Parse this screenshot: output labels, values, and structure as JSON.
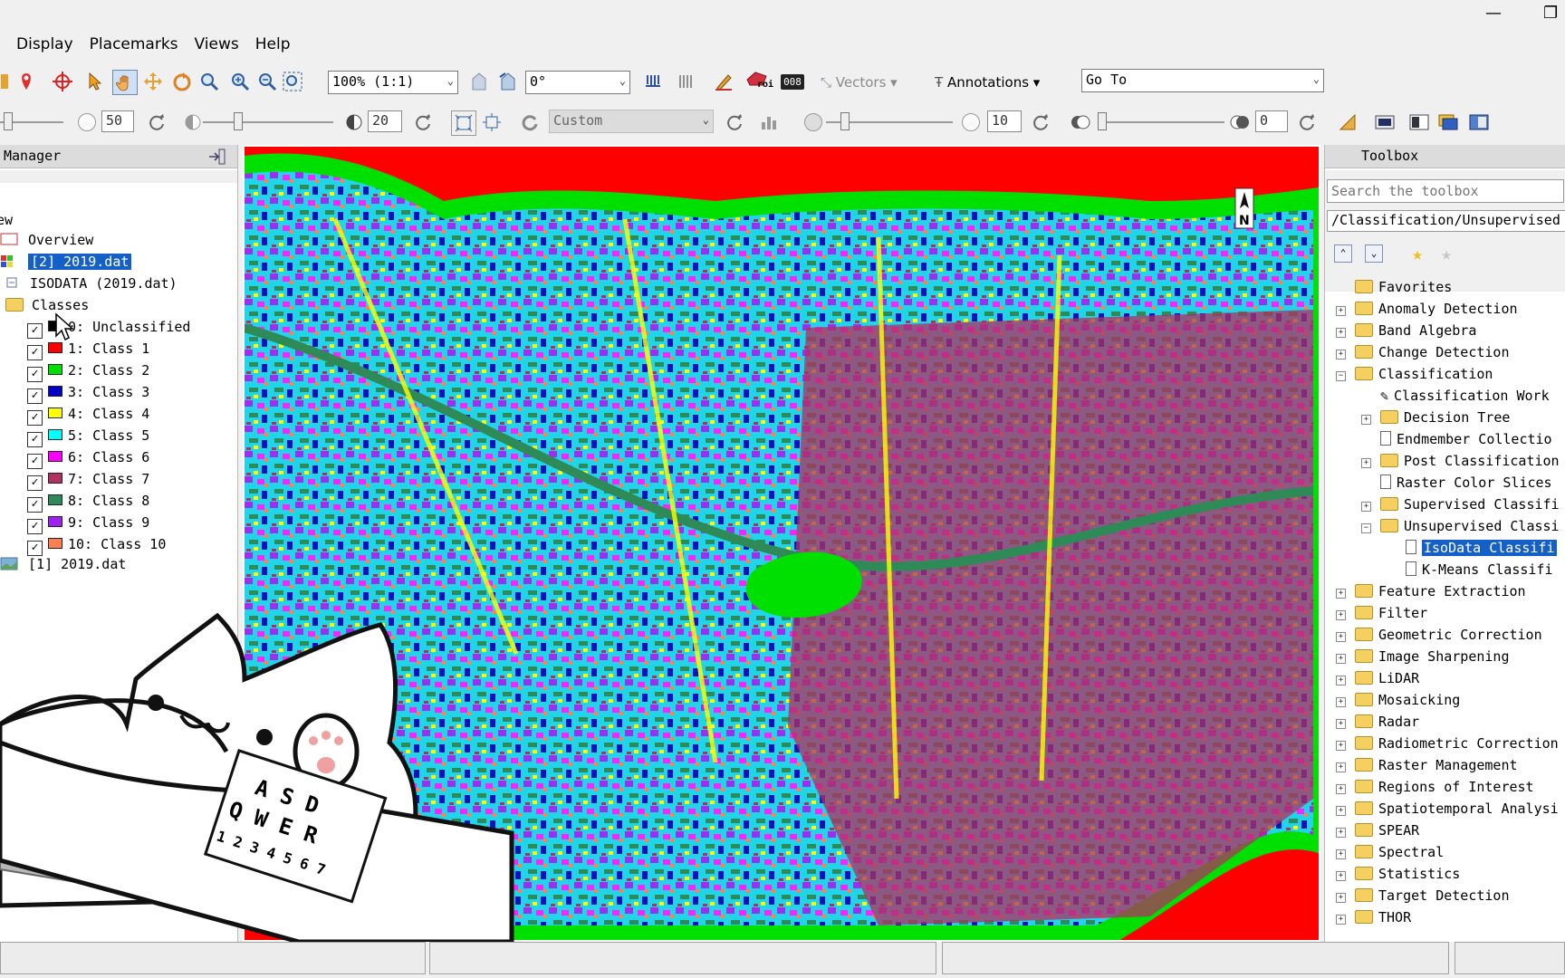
{
  "window": {
    "restore_glyph": "❐",
    "minimize_glyph": "—"
  },
  "menu": [
    "Display",
    "Placemarks",
    "Views",
    "Help"
  ],
  "toolbar1": {
    "zoom_value": "100% (1:1)",
    "rotation_value": "0°",
    "vectors_label": "Vectors",
    "annotations_label": "Annotations",
    "goto_value": "Go To",
    "roi_label": "roi",
    "counter_label": "008"
  },
  "toolbar2": {
    "brightness_value": "50",
    "contrast_value": "20",
    "stretch_value": "Custom",
    "sharpen_value": "10",
    "transparency_value": "0"
  },
  "layer_manager": {
    "title": "Manager",
    "view_label": "ew",
    "overview_label": "Overview",
    "selected_layer": "[2] 2019.dat",
    "isodata_label": "ISODATA (2019.dat)",
    "classes_label": "Classes",
    "classes": [
      {
        "label": "0: Unclassified",
        "color": "#000000"
      },
      {
        "label": "1: Class 1",
        "color": "#ff0000"
      },
      {
        "label": "2: Class 2",
        "color": "#00e000"
      },
      {
        "label": "3: Class 3",
        "color": "#0000c8"
      },
      {
        "label": "4: Class 4",
        "color": "#ffff00"
      },
      {
        "label": "5: Class 5",
        "color": "#00ffff"
      },
      {
        "label": "6: Class 6",
        "color": "#ff00ff"
      },
      {
        "label": "7: Class 7",
        "color": "#b03060"
      },
      {
        "label": "8: Class 8",
        "color": "#2e8b57"
      },
      {
        "label": "9: Class 9",
        "color": "#a020f0"
      },
      {
        "label": "10: Class 10",
        "color": "#ff7f50"
      }
    ],
    "base_layer": "[1] 2019.dat"
  },
  "view": {
    "north_label": "N"
  },
  "toolbox": {
    "title": "Toolbox",
    "search_placeholder": "Search the toolbox",
    "path": "/Classification/Unsupervised C",
    "items": [
      {
        "label": "Favorites",
        "kind": "folder",
        "depth": 0,
        "expander": "",
        "selected": false
      },
      {
        "label": "Anomaly Detection",
        "kind": "folder",
        "depth": 0,
        "expander": "+",
        "selected": false
      },
      {
        "label": "Band Algebra",
        "kind": "folder",
        "depth": 0,
        "expander": "+",
        "selected": false
      },
      {
        "label": "Change Detection",
        "kind": "folder",
        "depth": 0,
        "expander": "+",
        "selected": false
      },
      {
        "label": "Classification",
        "kind": "folder",
        "depth": 0,
        "expander": "−",
        "selected": false
      },
      {
        "label": "Classification Work",
        "kind": "wand",
        "depth": 1,
        "expander": "",
        "selected": false
      },
      {
        "label": "Decision Tree",
        "kind": "folder",
        "depth": 1,
        "expander": "+",
        "selected": false
      },
      {
        "label": "Endmember Collectio",
        "kind": "tool",
        "depth": 1,
        "expander": "",
        "selected": false
      },
      {
        "label": "Post Classification",
        "kind": "folder",
        "depth": 1,
        "expander": "+",
        "selected": false
      },
      {
        "label": "Raster Color Slices",
        "kind": "tool",
        "depth": 1,
        "expander": "",
        "selected": false
      },
      {
        "label": "Supervised Classifi",
        "kind": "folder",
        "depth": 1,
        "expander": "+",
        "selected": false
      },
      {
        "label": "Unsupervised Classi",
        "kind": "folder",
        "depth": 1,
        "expander": "−",
        "selected": false
      },
      {
        "label": "IsoData Classifi",
        "kind": "tool",
        "depth": 2,
        "expander": "",
        "selected": true
      },
      {
        "label": "K-Means Classifi",
        "kind": "tool",
        "depth": 2,
        "expander": "",
        "selected": false
      },
      {
        "label": "Feature Extraction",
        "kind": "folder",
        "depth": 0,
        "expander": "+",
        "selected": false
      },
      {
        "label": "Filter",
        "kind": "folder",
        "depth": 0,
        "expander": "+",
        "selected": false
      },
      {
        "label": "Geometric Correction",
        "kind": "folder",
        "depth": 0,
        "expander": "+",
        "selected": false
      },
      {
        "label": "Image Sharpening",
        "kind": "folder",
        "depth": 0,
        "expander": "+",
        "selected": false
      },
      {
        "label": "LiDAR",
        "kind": "folder",
        "depth": 0,
        "expander": "+",
        "selected": false
      },
      {
        "label": "Mosaicking",
        "kind": "folder",
        "depth": 0,
        "expander": "+",
        "selected": false
      },
      {
        "label": "Radar",
        "kind": "folder",
        "depth": 0,
        "expander": "+",
        "selected": false
      },
      {
        "label": "Radiometric Correction",
        "kind": "folder",
        "depth": 0,
        "expander": "+",
        "selected": false
      },
      {
        "label": "Raster Management",
        "kind": "folder",
        "depth": 0,
        "expander": "+",
        "selected": false
      },
      {
        "label": "Regions of Interest",
        "kind": "folder",
        "depth": 0,
        "expander": "+",
        "selected": false
      },
      {
        "label": "Spatiotemporal Analysi",
        "kind": "folder",
        "depth": 0,
        "expander": "+",
        "selected": false
      },
      {
        "label": "SPEAR",
        "kind": "folder",
        "depth": 0,
        "expander": "+",
        "selected": false
      },
      {
        "label": "Spectral",
        "kind": "folder",
        "depth": 0,
        "expander": "+",
        "selected": false
      },
      {
        "label": "Statistics",
        "kind": "folder",
        "depth": 0,
        "expander": "+",
        "selected": false
      },
      {
        "label": "Target Detection",
        "kind": "folder",
        "depth": 0,
        "expander": "+",
        "selected": false
      },
      {
        "label": "THOR",
        "kind": "folder",
        "depth": 0,
        "expander": "+",
        "selected": false
      }
    ]
  },
  "overlay": {
    "keyboard_row1": "A S D",
    "keyboard_row2": "Q W E R",
    "keyboard_row3": "1 2 3 4 5 6 7"
  }
}
